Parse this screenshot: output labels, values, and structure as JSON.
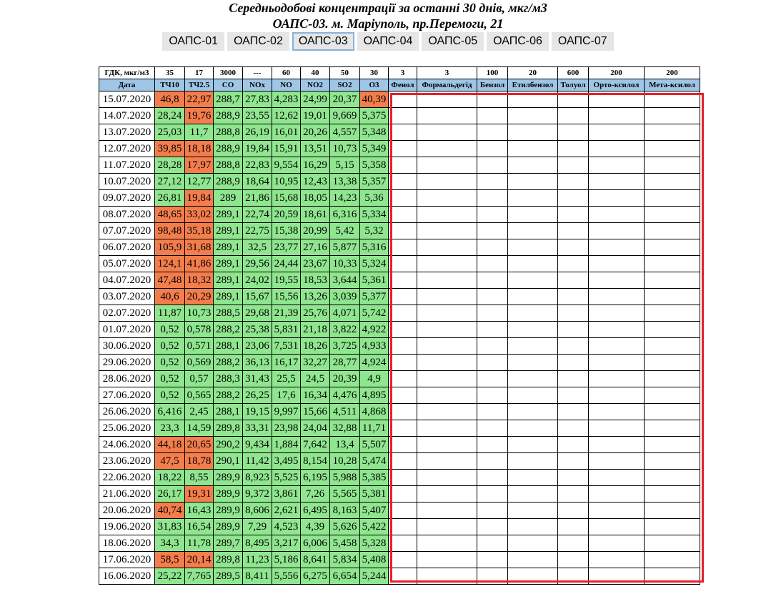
{
  "title_line1": "Середньодобові концентрації за останні 30 днів, мкг/м3",
  "title_line2": "ОАПС-03. м. Маріуполь, пр.Перемоги, 21",
  "tabs": [
    "ОАПС-01",
    "ОАПС-02",
    "ОАПС-03",
    "ОАПС-04",
    "ОАПС-05",
    "ОАПС-06",
    "ОАПС-07"
  ],
  "active_tab": "ОАПС-03",
  "colors": {
    "ok": "#8fe68f",
    "exceed": "#f47d4c",
    "header_blue": "#9fc6e7",
    "highlight_box": "#e8202a"
  },
  "table": {
    "gdk_label": "ГДК, мкг/м3",
    "gdk": [
      "35",
      "17",
      "3000",
      "---",
      "60",
      "40",
      "50",
      "30",
      "3",
      "3",
      "100",
      "20",
      "600",
      "200",
      "200"
    ],
    "date_label": "Дата",
    "columns": [
      "ТЧ10",
      "ТЧ2.5",
      "CO",
      "NOx",
      "NO",
      "NO2",
      "SO2",
      "O3",
      "Фенол",
      "Формальдегід",
      "Бензол",
      "Етилбензол",
      "Толуол",
      "Орто-ксилол",
      "Мета-ксилол"
    ],
    "rows": [
      {
        "date": "15.07.2020",
        "v": [
          "46,8",
          "22,97",
          "288,7",
          "27,83",
          "4,283",
          "24,99",
          "20,37",
          "40,39"
        ],
        "ex": [
          1,
          1,
          0,
          0,
          0,
          0,
          0,
          1
        ]
      },
      {
        "date": "14.07.2020",
        "v": [
          "28,24",
          "19,76",
          "288,9",
          "23,55",
          "12,62",
          "19,01",
          "9,669",
          "5,375"
        ],
        "ex": [
          0,
          1,
          0,
          0,
          0,
          0,
          0,
          0
        ]
      },
      {
        "date": "13.07.2020",
        "v": [
          "25,03",
          "11,7",
          "288,8",
          "26,19",
          "16,01",
          "20,26",
          "4,557",
          "5,348"
        ],
        "ex": [
          0,
          0,
          0,
          0,
          0,
          0,
          0,
          0
        ]
      },
      {
        "date": "12.07.2020",
        "v": [
          "39,85",
          "18,18",
          "288,9",
          "19,84",
          "15,91",
          "13,51",
          "10,73",
          "5,349"
        ],
        "ex": [
          1,
          1,
          0,
          0,
          0,
          0,
          0,
          0
        ]
      },
      {
        "date": "11.07.2020",
        "v": [
          "28,28",
          "17,97",
          "288,8",
          "22,83",
          "9,554",
          "16,29",
          "5,15",
          "5,358"
        ],
        "ex": [
          0,
          1,
          0,
          0,
          0,
          0,
          0,
          0
        ]
      },
      {
        "date": "10.07.2020",
        "v": [
          "27,12",
          "12,77",
          "288,9",
          "18,64",
          "10,95",
          "12,43",
          "13,38",
          "5,357"
        ],
        "ex": [
          0,
          0,
          0,
          0,
          0,
          0,
          0,
          0
        ]
      },
      {
        "date": "09.07.2020",
        "v": [
          "26,81",
          "19,84",
          "289",
          "21,86",
          "15,68",
          "18,05",
          "14,23",
          "5,36"
        ],
        "ex": [
          0,
          1,
          0,
          0,
          0,
          0,
          0,
          0
        ]
      },
      {
        "date": "08.07.2020",
        "v": [
          "48,65",
          "33,02",
          "289,1",
          "22,74",
          "20,59",
          "18,61",
          "6,316",
          "5,334"
        ],
        "ex": [
          1,
          1,
          0,
          0,
          0,
          0,
          0,
          0
        ]
      },
      {
        "date": "07.07.2020",
        "v": [
          "98,48",
          "35,18",
          "289,1",
          "22,75",
          "15,38",
          "20,99",
          "5,42",
          "5,32"
        ],
        "ex": [
          1,
          1,
          0,
          0,
          0,
          0,
          0,
          0
        ]
      },
      {
        "date": "06.07.2020",
        "v": [
          "105,9",
          "31,68",
          "289,1",
          "32,5",
          "23,77",
          "27,16",
          "5,877",
          "5,316"
        ],
        "ex": [
          1,
          1,
          0,
          0,
          0,
          0,
          0,
          0
        ]
      },
      {
        "date": "05.07.2020",
        "v": [
          "124,1",
          "41,86",
          "289,1",
          "29,56",
          "24,44",
          "23,67",
          "10,33",
          "5,324"
        ],
        "ex": [
          1,
          1,
          0,
          0,
          0,
          0,
          0,
          0
        ]
      },
      {
        "date": "04.07.2020",
        "v": [
          "47,48",
          "18,32",
          "289,1",
          "24,02",
          "19,55",
          "18,53",
          "3,644",
          "5,361"
        ],
        "ex": [
          1,
          1,
          0,
          0,
          0,
          0,
          0,
          0
        ]
      },
      {
        "date": "03.07.2020",
        "v": [
          "40,6",
          "20,29",
          "289,1",
          "15,67",
          "15,56",
          "13,26",
          "3,039",
          "5,377"
        ],
        "ex": [
          1,
          1,
          0,
          0,
          0,
          0,
          0,
          0
        ]
      },
      {
        "date": "02.07.2020",
        "v": [
          "11,87",
          "10,73",
          "288,5",
          "29,68",
          "21,39",
          "25,76",
          "4,071",
          "5,742"
        ],
        "ex": [
          0,
          0,
          0,
          0,
          0,
          0,
          0,
          0
        ]
      },
      {
        "date": "01.07.2020",
        "v": [
          "0,52",
          "0,578",
          "288,2",
          "25,38",
          "5,831",
          "21,18",
          "3,822",
          "4,922"
        ],
        "ex": [
          0,
          0,
          0,
          0,
          0,
          0,
          0,
          0
        ]
      },
      {
        "date": "30.06.2020",
        "v": [
          "0,52",
          "0,571",
          "288,1",
          "23,06",
          "7,531",
          "18,26",
          "3,725",
          "4,933"
        ],
        "ex": [
          0,
          0,
          0,
          0,
          0,
          0,
          0,
          0
        ]
      },
      {
        "date": "29.06.2020",
        "v": [
          "0,52",
          "0,569",
          "288,2",
          "36,13",
          "16,17",
          "32,27",
          "28,77",
          "4,924"
        ],
        "ex": [
          0,
          0,
          0,
          0,
          0,
          0,
          0,
          0
        ]
      },
      {
        "date": "28.06.2020",
        "v": [
          "0,52",
          "0,57",
          "288,3",
          "31,43",
          "25,5",
          "24,5",
          "20,39",
          "4,9"
        ],
        "ex": [
          0,
          0,
          0,
          0,
          0,
          0,
          0,
          0
        ]
      },
      {
        "date": "27.06.2020",
        "v": [
          "0,52",
          "0,565",
          "288,2",
          "26,25",
          "17,6",
          "16,34",
          "4,476",
          "4,895"
        ],
        "ex": [
          0,
          0,
          0,
          0,
          0,
          0,
          0,
          0
        ]
      },
      {
        "date": "26.06.2020",
        "v": [
          "6,416",
          "2,45",
          "288,1",
          "19,15",
          "9,997",
          "15,66",
          "4,511",
          "4,868"
        ],
        "ex": [
          0,
          0,
          0,
          0,
          0,
          0,
          0,
          0
        ]
      },
      {
        "date": "25.06.2020",
        "v": [
          "23,3",
          "14,59",
          "289,8",
          "33,31",
          "23,98",
          "24,04",
          "32,88",
          "11,71"
        ],
        "ex": [
          0,
          0,
          0,
          0,
          0,
          0,
          0,
          0
        ]
      },
      {
        "date": "24.06.2020",
        "v": [
          "44,18",
          "20,65",
          "290,2",
          "9,434",
          "1,884",
          "7,642",
          "13,4",
          "5,507"
        ],
        "ex": [
          1,
          1,
          0,
          0,
          0,
          0,
          0,
          0
        ]
      },
      {
        "date": "23.06.2020",
        "v": [
          "47,5",
          "18,78",
          "290,1",
          "11,42",
          "3,495",
          "8,154",
          "10,28",
          "5,474"
        ],
        "ex": [
          1,
          1,
          0,
          0,
          0,
          0,
          0,
          0
        ]
      },
      {
        "date": "22.06.2020",
        "v": [
          "18,22",
          "8,55",
          "289,9",
          "8,923",
          "5,525",
          "6,195",
          "5,988",
          "5,385"
        ],
        "ex": [
          0,
          0,
          0,
          0,
          0,
          0,
          0,
          0
        ]
      },
      {
        "date": "21.06.2020",
        "v": [
          "26,17",
          "19,31",
          "289,9",
          "9,372",
          "3,861",
          "7,26",
          "5,565",
          "5,381"
        ],
        "ex": [
          0,
          1,
          0,
          0,
          0,
          0,
          0,
          0
        ]
      },
      {
        "date": "20.06.2020",
        "v": [
          "40,74",
          "16,43",
          "289,9",
          "8,606",
          "2,621",
          "6,495",
          "8,163",
          "5,407"
        ],
        "ex": [
          1,
          0,
          0,
          0,
          0,
          0,
          0,
          0
        ]
      },
      {
        "date": "19.06.2020",
        "v": [
          "31,83",
          "16,54",
          "289,9",
          "7,29",
          "4,523",
          "4,39",
          "5,626",
          "5,422"
        ],
        "ex": [
          0,
          0,
          0,
          0,
          0,
          0,
          0,
          0
        ]
      },
      {
        "date": "18.06.2020",
        "v": [
          "34,3",
          "11,78",
          "289,7",
          "8,495",
          "3,217",
          "6,006",
          "5,458",
          "5,328"
        ],
        "ex": [
          0,
          0,
          0,
          0,
          0,
          0,
          0,
          0
        ]
      },
      {
        "date": "17.06.2020",
        "v": [
          "58,5",
          "20,14",
          "289,8",
          "11,23",
          "5,186",
          "8,641",
          "5,834",
          "5,408"
        ],
        "ex": [
          1,
          1,
          0,
          0,
          0,
          0,
          0,
          0
        ]
      },
      {
        "date": "16.06.2020",
        "v": [
          "25,22",
          "7,765",
          "289,5",
          "8,411",
          "5,556",
          "6,275",
          "6,654",
          "5,244"
        ],
        "ex": [
          0,
          0,
          0,
          0,
          0,
          0,
          0,
          0
        ]
      }
    ]
  }
}
